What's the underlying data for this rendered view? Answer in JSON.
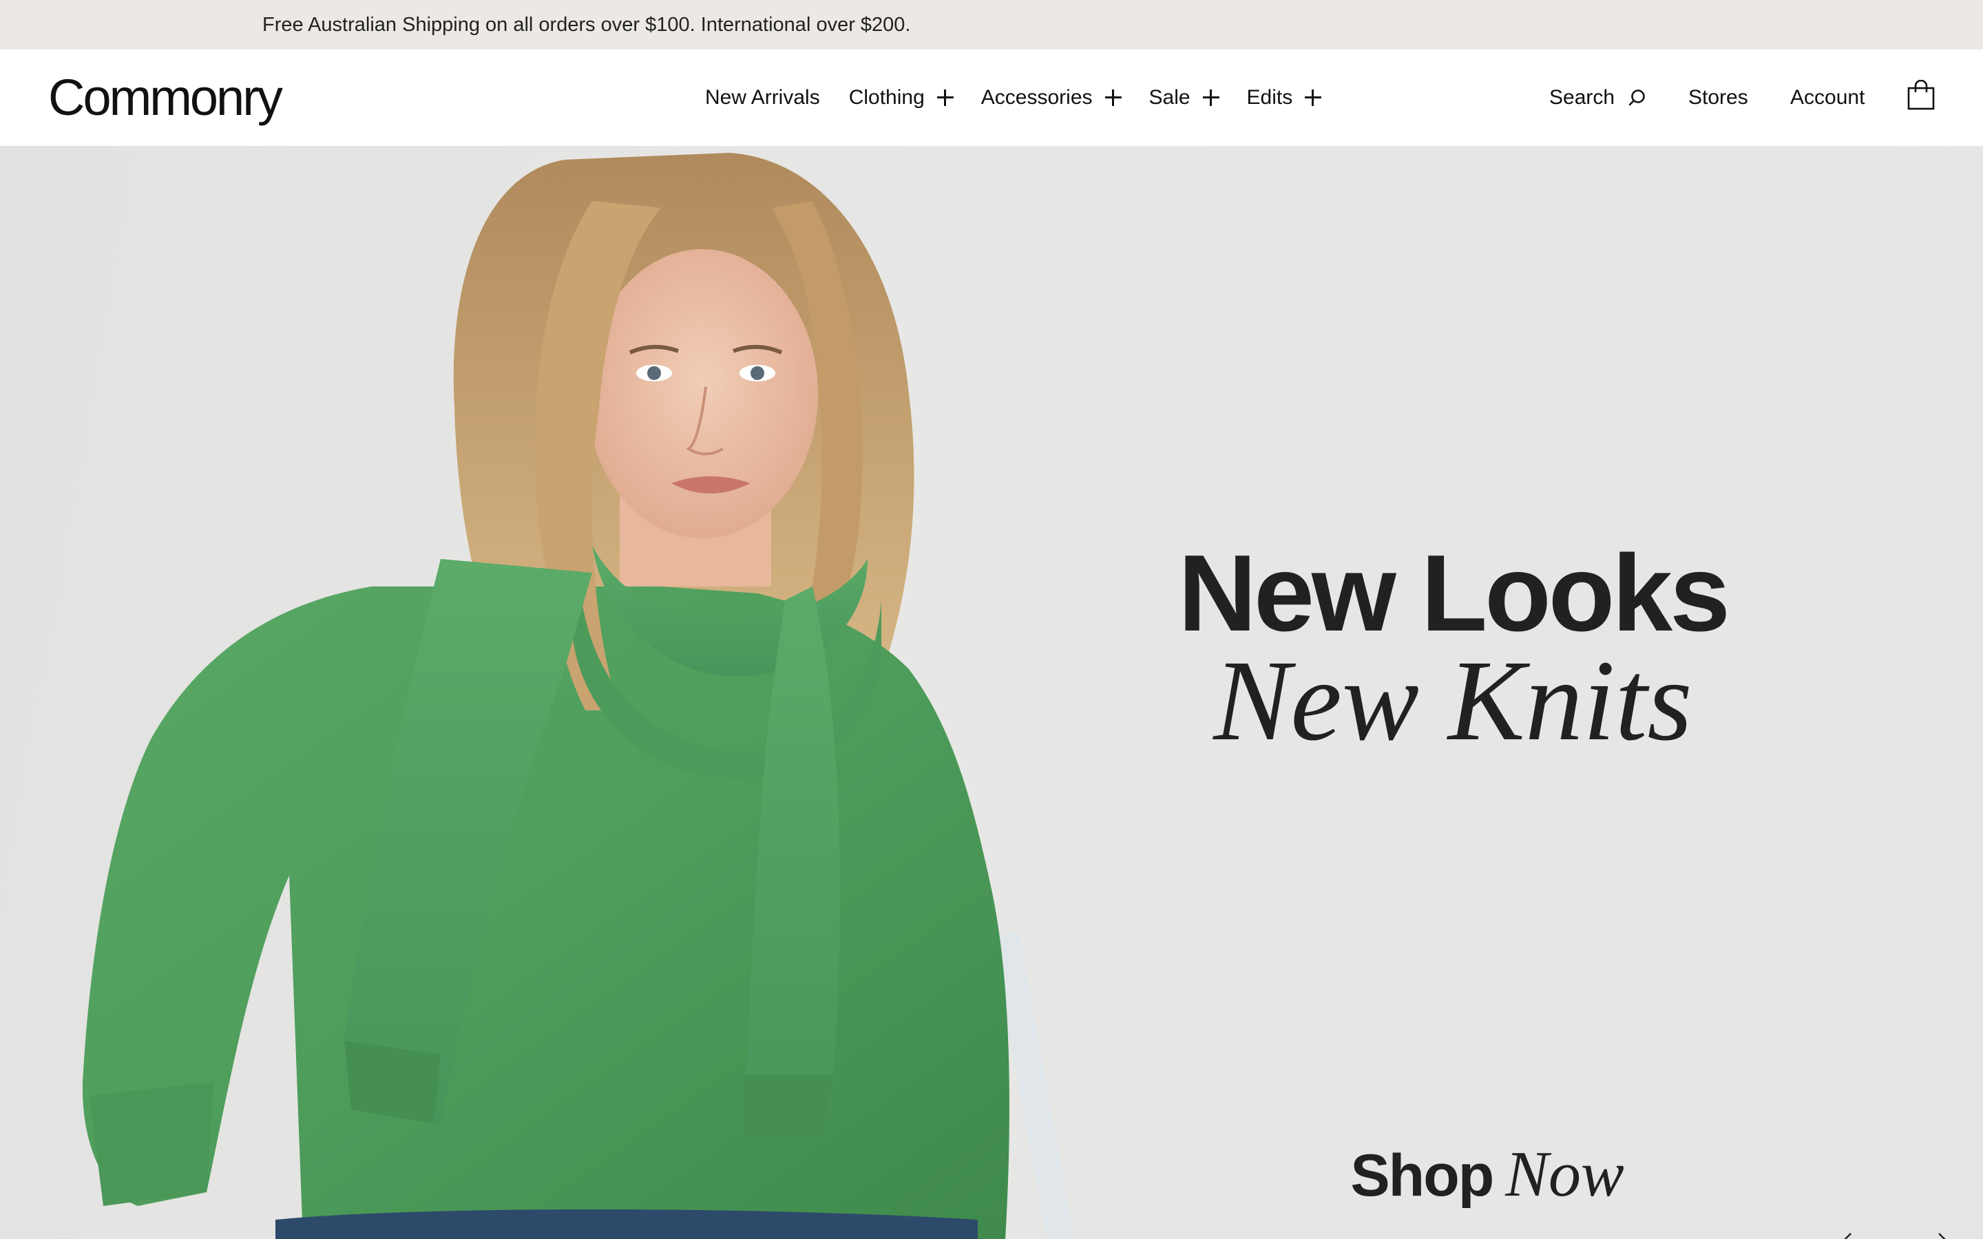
{
  "announcement": {
    "text": "Free Australian Shipping on all orders over $100. International over $200."
  },
  "header": {
    "logo": "Commonry",
    "nav": [
      {
        "label": "New Arrivals",
        "expandable": false
      },
      {
        "label": "Clothing",
        "expandable": true
      },
      {
        "label": "Accessories",
        "expandable": true
      },
      {
        "label": "Sale",
        "expandable": true
      },
      {
        "label": "Edits",
        "expandable": true
      }
    ],
    "search_label": "Search",
    "stores_label": "Stores",
    "account_label": "Account",
    "icons": {
      "search": "search-icon",
      "bag": "shopping-bag-icon",
      "expand": "plus-icon"
    }
  },
  "hero": {
    "headline_line1": "New Looks",
    "headline_line2": "New Knits",
    "cta_bold": "Shop",
    "cta_italic": "Now",
    "image": "woman-in-green-knit-sweater-and-scarf",
    "colors": {
      "background": "#e5e5e3",
      "sweater": "#4e9d5b",
      "text": "#222120"
    },
    "carousel": {
      "prev_icon": "chevron-left-icon",
      "next_icon": "chevron-right-icon"
    }
  }
}
